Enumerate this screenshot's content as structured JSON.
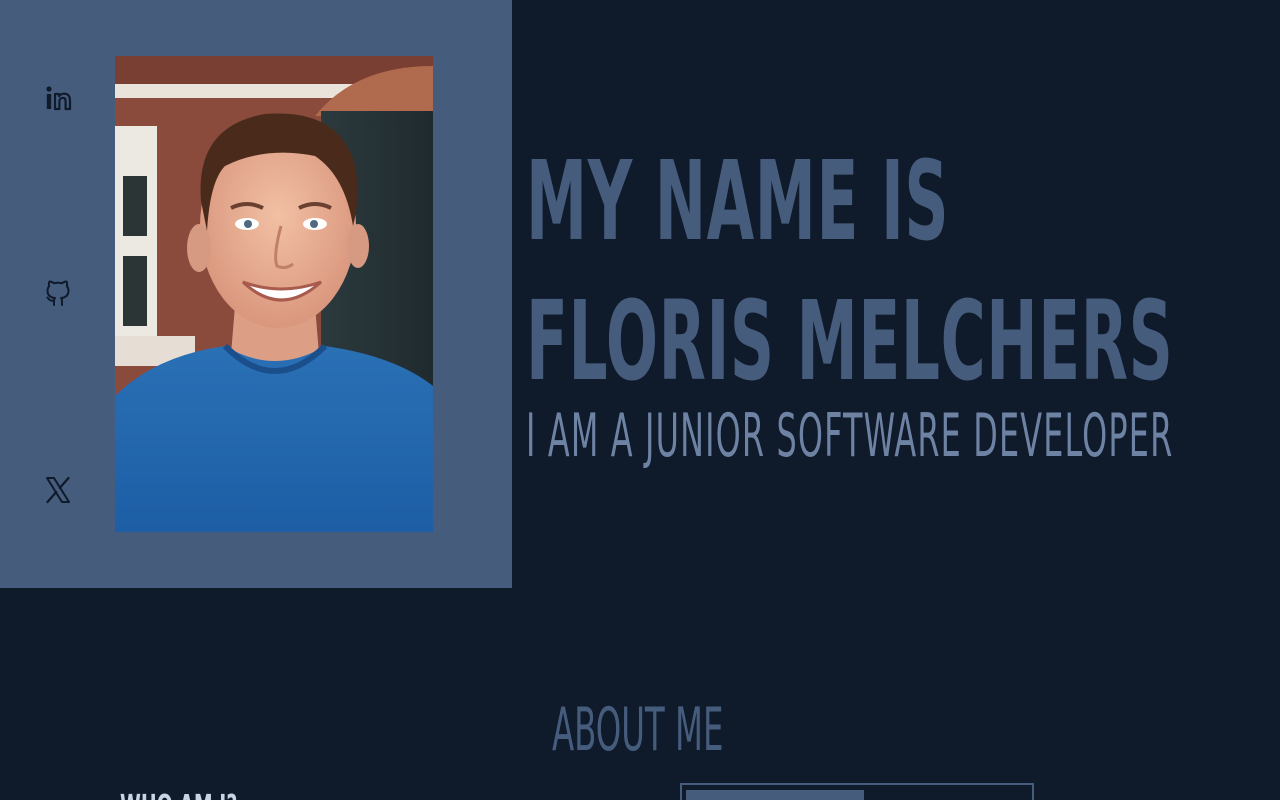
{
  "hero": {
    "headline_line1": "MY NAME IS",
    "headline_line2": "FLORIS MELCHERS",
    "subtitle": "I AM A JUNIOR SOFTWARE DEVELOPER"
  },
  "social": [
    {
      "icon": "linkedin-icon"
    },
    {
      "icon": "github-icon"
    },
    {
      "icon": "x-icon"
    }
  ],
  "about": {
    "title": "ABOUT ME",
    "who_heading": "WHO AM I?"
  },
  "colors": {
    "background": "#0f1a2b",
    "panel": "#465c7d",
    "headline": "#465c7d",
    "subtitle": "#6e83a4"
  }
}
